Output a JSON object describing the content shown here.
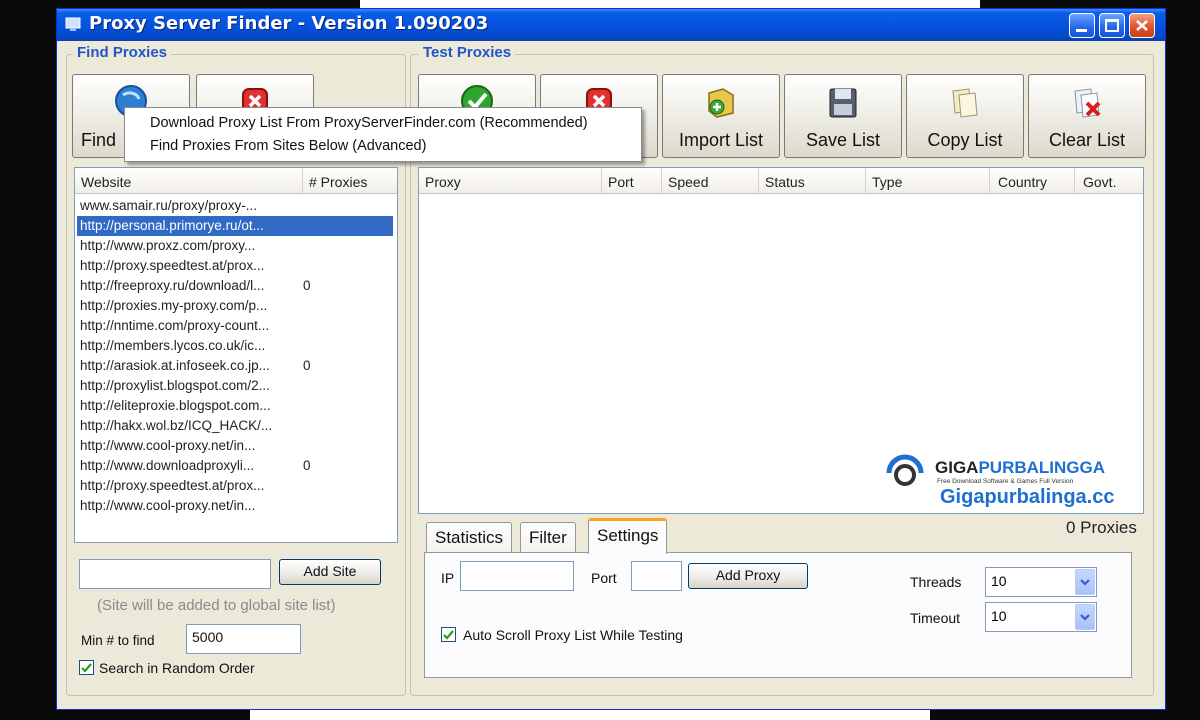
{
  "window": {
    "title": "Proxy Server Finder - Version 1.090203"
  },
  "find_group": {
    "title": "Find Proxies",
    "find_button": "Find",
    "columns": [
      "Website",
      "# Proxies"
    ],
    "sites": [
      {
        "url": "www.samair.ru/proxy/proxy-...",
        "count": ""
      },
      {
        "url": "http://personal.primorye.ru/ot...",
        "count": "",
        "selected": true
      },
      {
        "url": "http://www.proxz.com/proxy...",
        "count": ""
      },
      {
        "url": "http://proxy.speedtest.at/prox...",
        "count": ""
      },
      {
        "url": "http://freeproxy.ru/download/l...",
        "count": "0"
      },
      {
        "url": "http://proxies.my-proxy.com/p...",
        "count": ""
      },
      {
        "url": "http://nntime.com/proxy-count...",
        "count": ""
      },
      {
        "url": "http://members.lycos.co.uk/ic...",
        "count": ""
      },
      {
        "url": "http://arasiok.at.infoseek.co.jp...",
        "count": "0"
      },
      {
        "url": "http://proxylist.blogspot.com/2...",
        "count": ""
      },
      {
        "url": "http://eliteproxie.blogspot.com...",
        "count": ""
      },
      {
        "url": "http://hakx.wol.bz/ICQ_HACK/...",
        "count": ""
      },
      {
        "url": "http://www.cool-proxy.net/in...",
        "count": ""
      },
      {
        "url": "http://www.downloadproxyli...",
        "count": "0"
      },
      {
        "url": "http://proxy.speedtest.at/prox...",
        "count": ""
      },
      {
        "url": "http://www.cool-proxy.net/in...",
        "count": ""
      }
    ],
    "add_site_value": "",
    "add_site_button": "Add Site",
    "add_site_note": "(Site will be added to global site list)",
    "min_to_find_label": "Min # to find",
    "min_to_find_value": "5000",
    "random_order_label": "Search in Random Order",
    "random_order_checked": true
  },
  "find_menu": {
    "items": [
      "Download Proxy List From ProxyServerFinder.com (Recommended)",
      "Find Proxies From Sites Below (Advanced)"
    ]
  },
  "test_group": {
    "title": "Test Proxies",
    "toolbar": {
      "import_list": "Import List",
      "save_list": "Save List",
      "copy_list": "Copy List",
      "clear_list": "Clear List"
    },
    "columns": [
      "Proxy",
      "Port",
      "Speed",
      "Status",
      "Type",
      "Country",
      "Govt."
    ],
    "proxy_count": "0 Proxies",
    "tabs": [
      "Statistics",
      "Filter",
      "Settings"
    ],
    "active_tab": "Settings",
    "settings": {
      "ip_label": "IP",
      "ip_value": "",
      "port_label": "Port",
      "port_value": "",
      "add_proxy_button": "Add Proxy",
      "threads_label": "Threads",
      "threads_value": "10",
      "timeout_label": "Timeout",
      "timeout_value": "10",
      "auto_scroll_label": "Auto Scroll Proxy List While Testing",
      "auto_scroll_checked": true
    }
  },
  "watermark": {
    "brand_a": "GIGA",
    "brand_b": "PURBALINGGA",
    "tagline": "Free Download Software & Games Full Version",
    "url": "Gigapurbalinga.cc"
  },
  "colors": {
    "title_bar": "#0553e0",
    "selection": "#316ac5",
    "group_title": "#2155c8",
    "active_tab_accent": "#ff9f2a"
  }
}
